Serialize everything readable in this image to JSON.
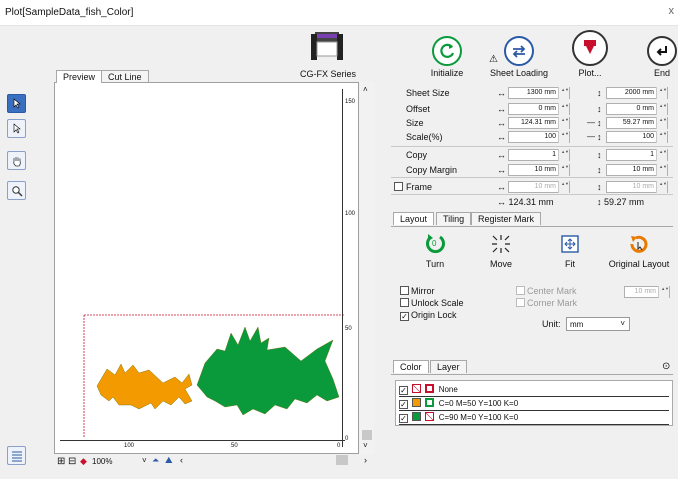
{
  "window": {
    "title": "Plot[SampleData_fish_Color]",
    "close": "x"
  },
  "tabs_left": {
    "preview": "Preview",
    "cut_line": "Cut Line"
  },
  "device": {
    "name": "CG-FX Series"
  },
  "toolbar": {
    "initialize": "Initialize",
    "sheet_loading": "Sheet Loading",
    "plot": "Plot...",
    "end": "End"
  },
  "ruler": {
    "v_top": "150",
    "v_mid": "100",
    "v_low": "50",
    "v_zero": "0",
    "h_100": "100",
    "h_50": "50",
    "h_0": "0"
  },
  "zoom": "100%",
  "settings": {
    "sheet_size": {
      "label": "Sheet Size",
      "w": "1300 mm",
      "h": "2000 mm"
    },
    "offset": {
      "label": "Offset",
      "w": "0 mm",
      "h": "0 mm"
    },
    "size": {
      "label": "Size",
      "w": "124.31 mm",
      "h": "59.27 mm"
    },
    "scale": {
      "label": "Scale(%)",
      "w": "100",
      "h": "100"
    },
    "copy": {
      "label": "Copy",
      "w": "1",
      "h": "1"
    },
    "copy_margin": {
      "label": "Copy Margin",
      "w": "10 mm",
      "h": "10 mm"
    },
    "frame": {
      "label": "Frame",
      "w": "10 mm",
      "h": "10 mm"
    },
    "total_w": "↔ 124.31 mm",
    "total_h": "↕ 59.27 mm"
  },
  "tabs_mid": {
    "layout": "Layout",
    "tiling": "Tiling",
    "register_mark": "Register Mark"
  },
  "layout": {
    "turn": "Turn",
    "turn_value": "0",
    "move": "Move",
    "fit": "Fit",
    "original_layout": "Original Layout",
    "mirror": "Mirror",
    "unlock_scale": "Unlock Scale",
    "origin_lock": "Origin Lock",
    "center_mark": "Center Mark",
    "corner_mark": "Corner Mark",
    "mark_size": "10 mm",
    "unit_label": "Unit:",
    "unit_value": "mm"
  },
  "tabs_bottom": {
    "color": "Color",
    "layer": "Layer"
  },
  "color_list": [
    {
      "label": "None",
      "swatch": "#ffffff"
    },
    {
      "label": "C=0 M=50 Y=100 K=0",
      "swatch": "#f29a00"
    },
    {
      "label": "C=90 M=0 Y=100 K=0",
      "swatch": "#0a9a3c"
    }
  ],
  "colors": {
    "accent_blue": "#3a6fc0",
    "fish_orange": "#f29a00",
    "fish_green": "#0a9a3c",
    "plot_red": "#c8102e"
  }
}
